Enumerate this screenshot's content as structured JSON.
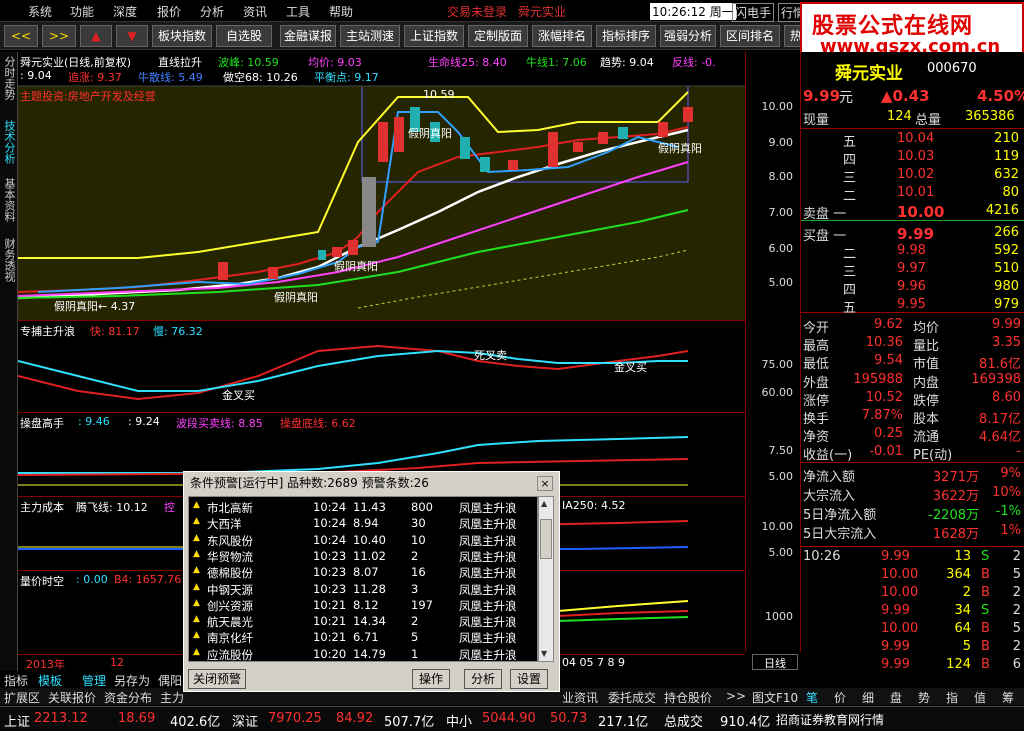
{
  "menu": {
    "items": [
      "系统",
      "功能",
      "深度",
      "报价",
      "分析",
      "资讯",
      "工具",
      "帮助"
    ],
    "notice1": "交易未登录",
    "notice2": "舜元实业",
    "time": "10:26:12 周一",
    "flash": "闪电手",
    "quote": "行情"
  },
  "toolbar": {
    "buttons": [
      "板块指数",
      "自选股",
      "金融谋报",
      "主站测速",
      "上证指数",
      "定制版面",
      "涨幅排名",
      "指标排序",
      "强弱分析",
      "区间排名",
      "热"
    ]
  },
  "watermark": {
    "line1": "股票公式在线网",
    "line2": "www.gszx.com.cn"
  },
  "lefttabs": [
    "分时走势",
    "技术分析",
    "基本资料",
    "财务透视"
  ],
  "main_chart": {
    "title": "舜元实业(日线,前复权)",
    "indicator": "直线拉升",
    "wave_peak": "波峰: 10.59",
    "avg": "均价: 9.03",
    "lifeline": "生命线25: 8.40",
    "bull": "牛线1: 7.06",
    "trend": "趋势: 9.04",
    "rev": "反线: -0.",
    "row2a": ": 9.04",
    "row2b": "追涨: 9.37",
    "row2c": "牛散线: 5.49",
    "row2d": "做空68: 10.26",
    "row2e": "平衡点: 9.17",
    "sector": "主题投资:房地产开发及经营",
    "high_label": "10.59",
    "low_label": "← 4.37",
    "annotations": [
      "假阴真阳",
      "假阴真阳",
      "假阴真阳",
      "假阴真阳",
      "假阴真阳"
    ],
    "yaxis": [
      "10.00",
      "9.00",
      "8.00",
      "7.00",
      "6.00",
      "5.00"
    ]
  },
  "pane2": {
    "title": "专捕主升浪",
    "fast": "快: 81.17",
    "slow": "慢: 76.32",
    "dead": "死叉卖",
    "gold1": "金叉买",
    "gold2": "金叉买",
    "yaxis": [
      "75.00",
      "60.00"
    ]
  },
  "pane3": {
    "title": "操盘高手",
    "v1": ": 9.46",
    "v2": ": 9.24",
    "band": "波段买卖线: 8.85",
    "bottom": "操盘底线: 6.62",
    "yaxis": [
      "7.50",
      "5.00"
    ]
  },
  "pane4": {
    "title": "主力成本",
    "fly": "腾飞线: 10.12",
    "ctrl": "控",
    "ma": "IA250: 4.52",
    "yaxis": [
      "10.00",
      "5.00"
    ]
  },
  "pane5": {
    "title": "量价时空",
    "v1": ": 0.00",
    "v2": "B4: 1657.76",
    "yaxis": [
      "1000"
    ]
  },
  "xaxis": {
    "left": "2013年",
    "mid": "12",
    "right": "04 05 7 8 9",
    "tab": "日线"
  },
  "dialog": {
    "title": "条件预警[运行中] 品种数:2689 预警条数:26",
    "rows": [
      [
        "市北高新",
        "10:24",
        "11.43",
        "800",
        "凤凰主升浪"
      ],
      [
        "大西洋",
        "10:24",
        "8.94",
        "30",
        "凤凰主升浪"
      ],
      [
        "东风股份",
        "10:24",
        "10.40",
        "10",
        "凤凰主升浪"
      ],
      [
        "华贸物流",
        "10:23",
        "11.02",
        "2",
        "凤凰主升浪"
      ],
      [
        "德棉股份",
        "10:23",
        "8.07",
        "16",
        "凤凰主升浪"
      ],
      [
        "中钢天源",
        "10:23",
        "11.28",
        "3",
        "凤凰主升浪"
      ],
      [
        "创兴资源",
        "10:21",
        "8.12",
        "197",
        "凤凰主升浪"
      ],
      [
        "航天晨光",
        "10:21",
        "14.34",
        "2",
        "凤凰主升浪"
      ],
      [
        "南京化纤",
        "10:21",
        "6.71",
        "5",
        "凤凰主升浪"
      ],
      [
        "应流股份",
        "10:20",
        "14.79",
        "1",
        "凤凰主升浪"
      ]
    ],
    "btn_close": "关闭预警",
    "btn_op": "操作",
    "btn_analyze": "分析",
    "btn_set": "设置"
  },
  "quote": {
    "name": "舜元实业",
    "code": "000670",
    "price": "9.99",
    "unit": "元",
    "change": "▲0.43",
    "pct": "4.50%",
    "now_label": "现量",
    "now": "124",
    "total_label": "总量",
    "total": "365386",
    "sells": [
      [
        "五",
        "10.04",
        "210"
      ],
      [
        "四",
        "10.03",
        "119"
      ],
      [
        "三",
        "10.02",
        "632"
      ],
      [
        "二",
        "10.01",
        "80"
      ],
      [
        "卖盘 一",
        "10.00",
        "4216"
      ]
    ],
    "buys": [
      [
        "买盘 一",
        "9.99",
        "266"
      ],
      [
        "二",
        "9.98",
        "592"
      ],
      [
        "三",
        "9.97",
        "510"
      ],
      [
        "四",
        "9.96",
        "980"
      ],
      [
        "五",
        "9.95",
        "979"
      ]
    ],
    "stats": [
      [
        "今开",
        "9.62",
        "均价",
        "9.99"
      ],
      [
        "最高",
        "10.36",
        "量比",
        "3.35"
      ],
      [
        "最低",
        "9.54",
        "市值",
        "81.6亿"
      ],
      [
        "外盘",
        "195988",
        "内盘",
        "169398"
      ],
      [
        "涨停",
        "10.52",
        "跌停",
        "8.60"
      ],
      [
        "换手",
        "7.87%",
        "股本",
        "8.17亿"
      ],
      [
        "净资",
        "0.25",
        "流通",
        "4.64亿"
      ],
      [
        "收益(一)",
        "-0.01",
        "PE(动)",
        "-"
      ]
    ],
    "flows": [
      [
        "净流入额",
        "3271万",
        "9%"
      ],
      [
        "大宗流入",
        "3622万",
        "10%"
      ],
      [
        "5日净流入额",
        "-2208万",
        "-1%"
      ],
      [
        "5日大宗流入",
        "1628万",
        "1%"
      ]
    ],
    "ticks": [
      [
        "10:26",
        "9.99",
        "13",
        "S",
        "2"
      ],
      [
        "",
        "10.00",
        "364",
        "B",
        "5"
      ],
      [
        "",
        "10.00",
        "2",
        "B",
        "2"
      ],
      [
        "",
        "9.99",
        "34",
        "S",
        "2"
      ],
      [
        "",
        "10.00",
        "64",
        "B",
        "5"
      ],
      [
        "",
        "9.99",
        "5",
        "B",
        "2"
      ],
      [
        "",
        "9.99",
        "124",
        "B",
        "6"
      ]
    ]
  },
  "bottom1": [
    "指标",
    "模板",
    "管理",
    "另存为",
    "偶阳"
  ],
  "bottom2": [
    "扩展区",
    "关联报价",
    "资金分布",
    "主力"
  ],
  "bottom2r": [
    "业资讯",
    "委托成交",
    "持仓股价",
    ">>",
    "图文F10"
  ],
  "rtabs": [
    "笔",
    "价",
    "细",
    "盘",
    "势",
    "指",
    "值",
    "筹"
  ],
  "status": {
    "sh_label": "上证",
    "sh": "2213.12",
    "sh_chg": "18.69",
    "sh_amt": "402.6亿",
    "sz_label": "深证",
    "sz": "7970.25",
    "sz_chg": "84.92",
    "sz_amt": "507.7亿",
    "zx_label": "中小",
    "zx": "5044.90",
    "zx_chg": "50.73",
    "zx_amt": "217.1亿",
    "tot_label": "总成交",
    "tot": "910.4亿",
    "broker": "招商证券教育网行情"
  }
}
